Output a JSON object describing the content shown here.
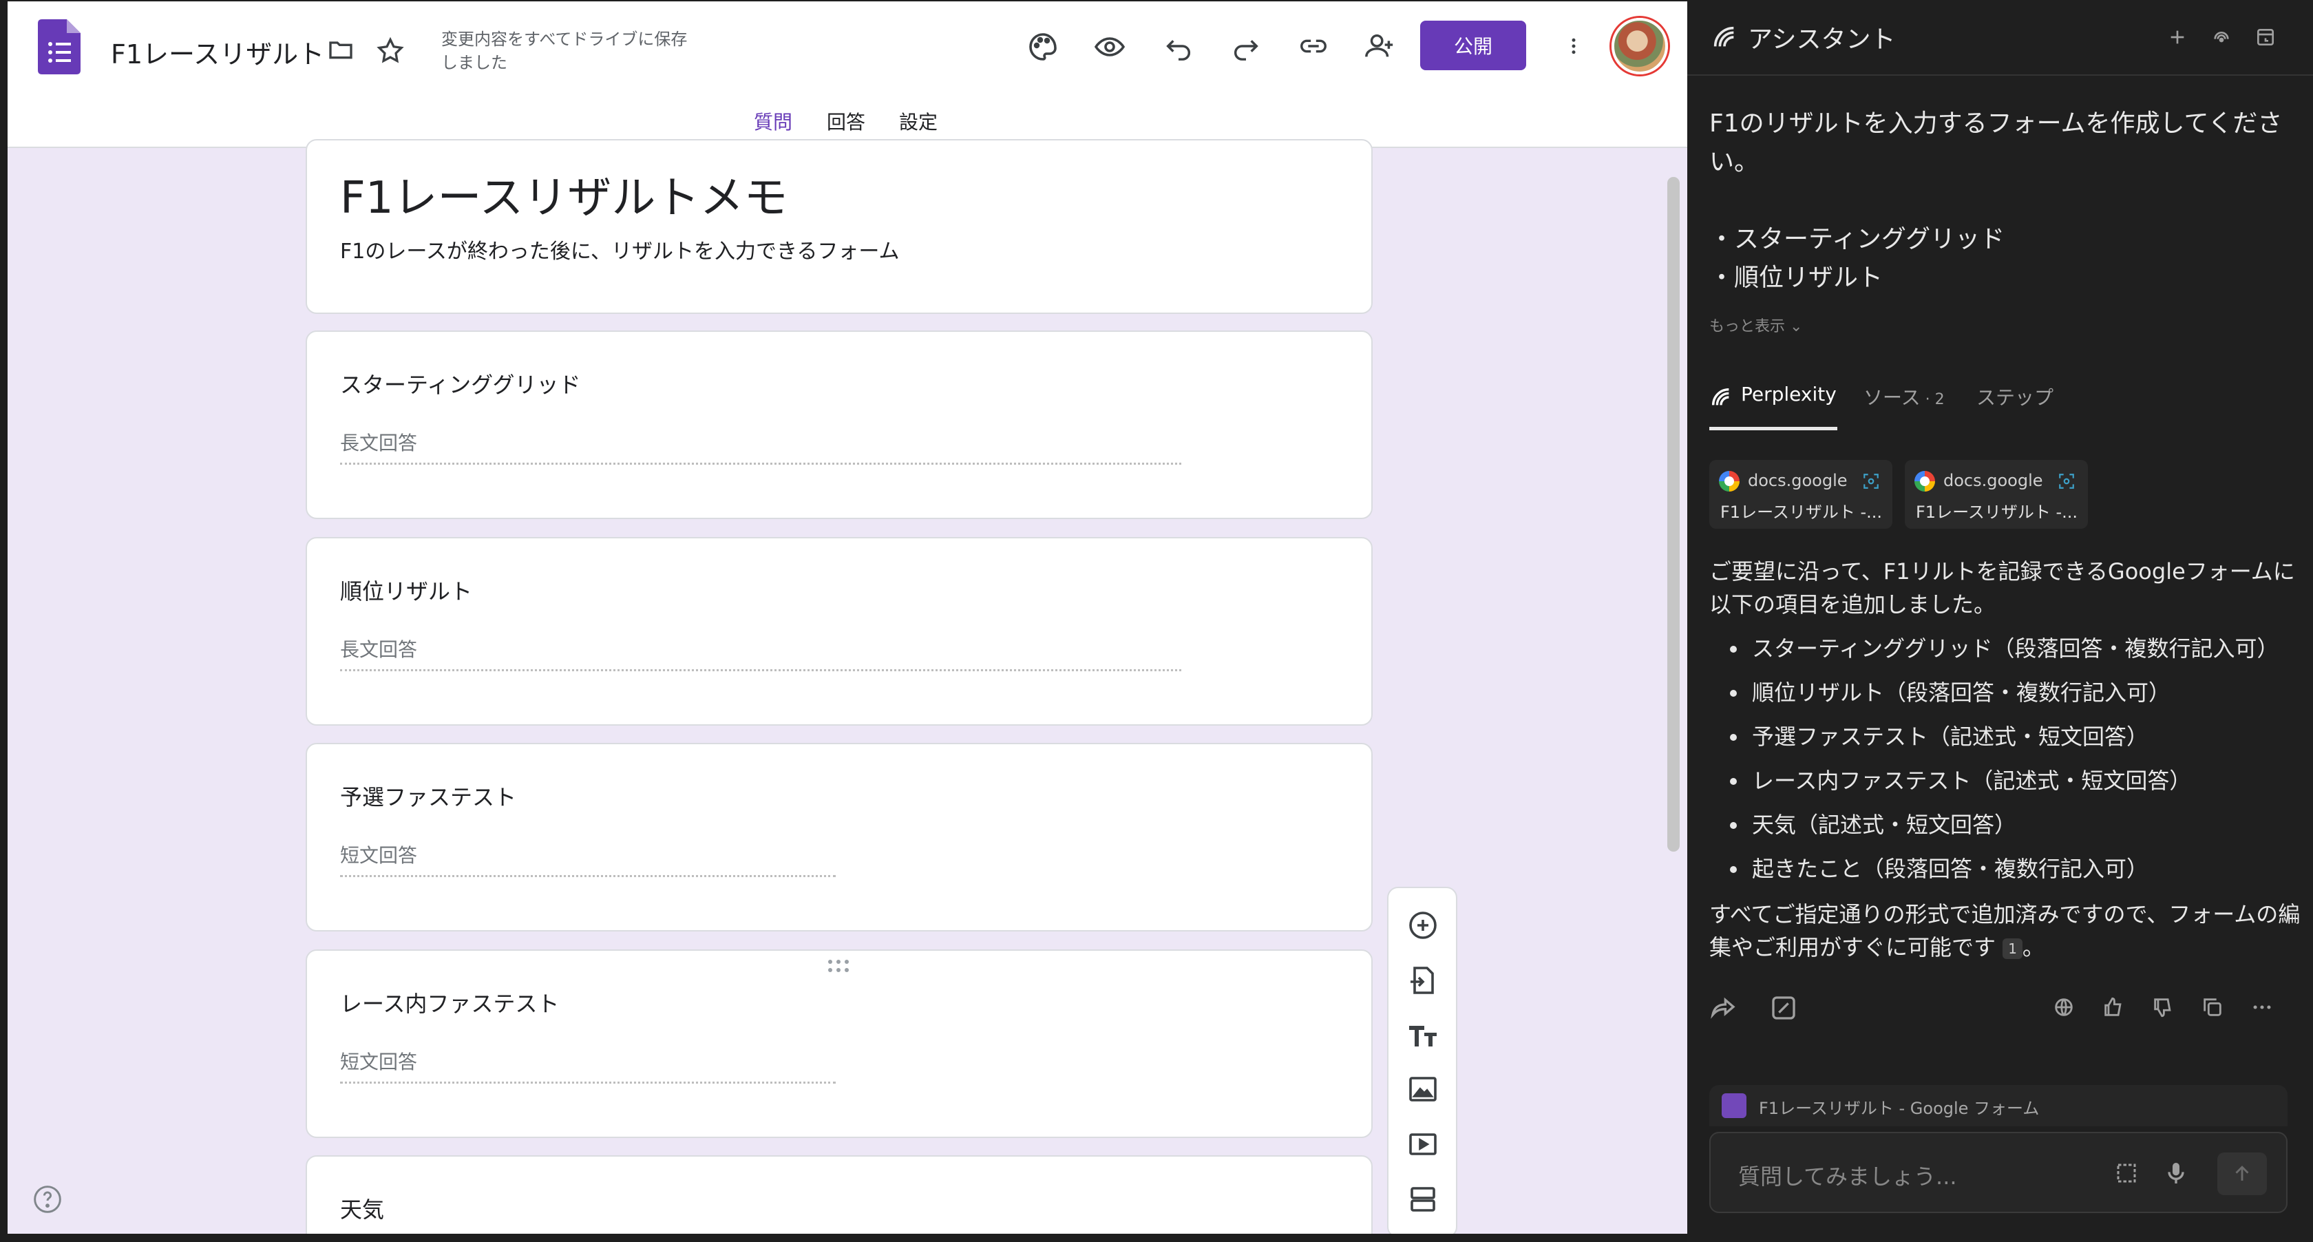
{
  "forms": {
    "doc_title": "F1レースリザルト",
    "save_status": "変更内容をすべてドライブに保存しました",
    "publish_label": "公開",
    "tabs": [
      "質問",
      "回答",
      "設定"
    ],
    "form_title": "F1レースリザルトメモ",
    "form_description": "F1のレースが終わった後に、リザルトを入力できるフォーム",
    "questions": [
      {
        "title": "スターティンググリッド",
        "answer_hint": "長文回答"
      },
      {
        "title": "順位リザルト",
        "answer_hint": "長文回答"
      },
      {
        "title": "予選ファステスト",
        "answer_hint": "短文回答"
      },
      {
        "title": "レース内ファステスト",
        "answer_hint": "短文回答"
      },
      {
        "title": "天気",
        "answer_hint": ""
      }
    ],
    "header_icons": [
      "forms-logo-icon",
      "folder-icon",
      "star-icon",
      "palette-icon",
      "preview-eye-icon",
      "undo-icon",
      "redo-icon",
      "link-icon",
      "add-collaborator-icon",
      "more-vert-icon"
    ],
    "toolbar_icons": [
      "add-question-icon",
      "import-questions-icon",
      "add-title-icon",
      "add-image-icon",
      "add-video-icon",
      "add-section-icon"
    ],
    "accent": "#673ab7"
  },
  "assistant": {
    "title": "アシスタント",
    "prompt_lines": [
      "F1のリザルトを入力するフォームを作成してください。",
      "",
      "・スターティンググリッド",
      "・順位リザルト"
    ],
    "show_more": "もっと表示",
    "tabs": {
      "perplexity": "Perplexity",
      "sources": "ソース",
      "sources_count": "2",
      "steps": "ステップ"
    },
    "sources": [
      {
        "domain": "docs.google",
        "title": "F1レースリザルト -..."
      },
      {
        "domain": "docs.google",
        "title": "F1レースリザルト -..."
      }
    ],
    "answer_intro": "ご要望に沿って、F1リルトを記録できるGoogleフォームに以下の項目を追加しました。",
    "answer_items": [
      "スターティンググリッド（段落回答・複数行記入可）",
      "順位リザルト（段落回答・複数行記入可）",
      "予選ファステスト（記述式・短文回答）",
      "レース内ファステスト（記述式・短文回答）",
      "天気（記述式・短文回答）",
      "起きたこと（段落回答・複数行記入可）"
    ],
    "answer_outro": "すべてご指定通りの形式で追加済みですので、フォームの編集やご利用がすぐに可能です",
    "citation": "1",
    "answer_end": "。",
    "context_label": "F1レースリザルト - Google フォーム",
    "input_placeholder": "質問してみましょう..."
  }
}
